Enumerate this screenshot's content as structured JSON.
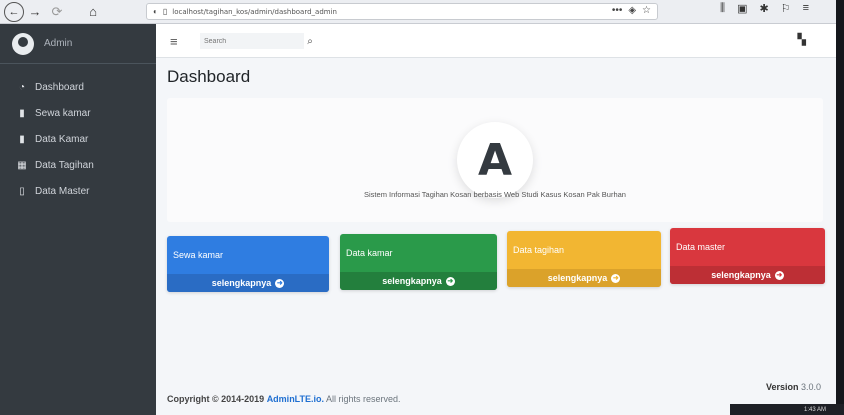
{
  "browser": {
    "url": "localhost/tagihan_kos/admin/dashboard_admin",
    "colors": {
      "chrome": "#eceef2"
    }
  },
  "sidebar": {
    "brand": "Admin",
    "items": [
      {
        "label": "Dashboard",
        "icon": "tachometer-icon"
      },
      {
        "label": "Sewa kamar",
        "icon": "file-icon"
      },
      {
        "label": "Data Kamar",
        "icon": "file-icon"
      },
      {
        "label": "Data Tagihan",
        "icon": "calendar-icon"
      },
      {
        "label": "Data Master",
        "icon": "document-icon"
      }
    ]
  },
  "navbar": {
    "search_placeholder": "Search"
  },
  "main": {
    "title": "Dashboard",
    "logo_letter": "A",
    "description": "Sistem Informasi Tagihan Kosan berbasis Web Studi Kasus Kosan Pak Burhan",
    "boxes": [
      {
        "title": "Sewa kamar",
        "more": "selengkapnya",
        "color": "#2f7de1",
        "footer_color": "#2a6cc4"
      },
      {
        "title": "Data kamar",
        "more": "selengkapnya",
        "color": "#2a9a4a",
        "footer_color": "#237f3d"
      },
      {
        "title": "Data tagihan",
        "more": "selengkapnya",
        "color": "#f2b632",
        "footer_color": "#dba22a"
      },
      {
        "title": "Data master",
        "more": "selengkapnya",
        "color": "#d9373e",
        "footer_color": "#bd2f35"
      }
    ]
  },
  "footer": {
    "copyright": "Copyright © 2014-2019",
    "link": "AdminLTE.io.",
    "rights": "All rights reserved.",
    "version_label": "Version",
    "version": "3.0.0"
  },
  "taskbar": {
    "time": "1:43 AM"
  }
}
